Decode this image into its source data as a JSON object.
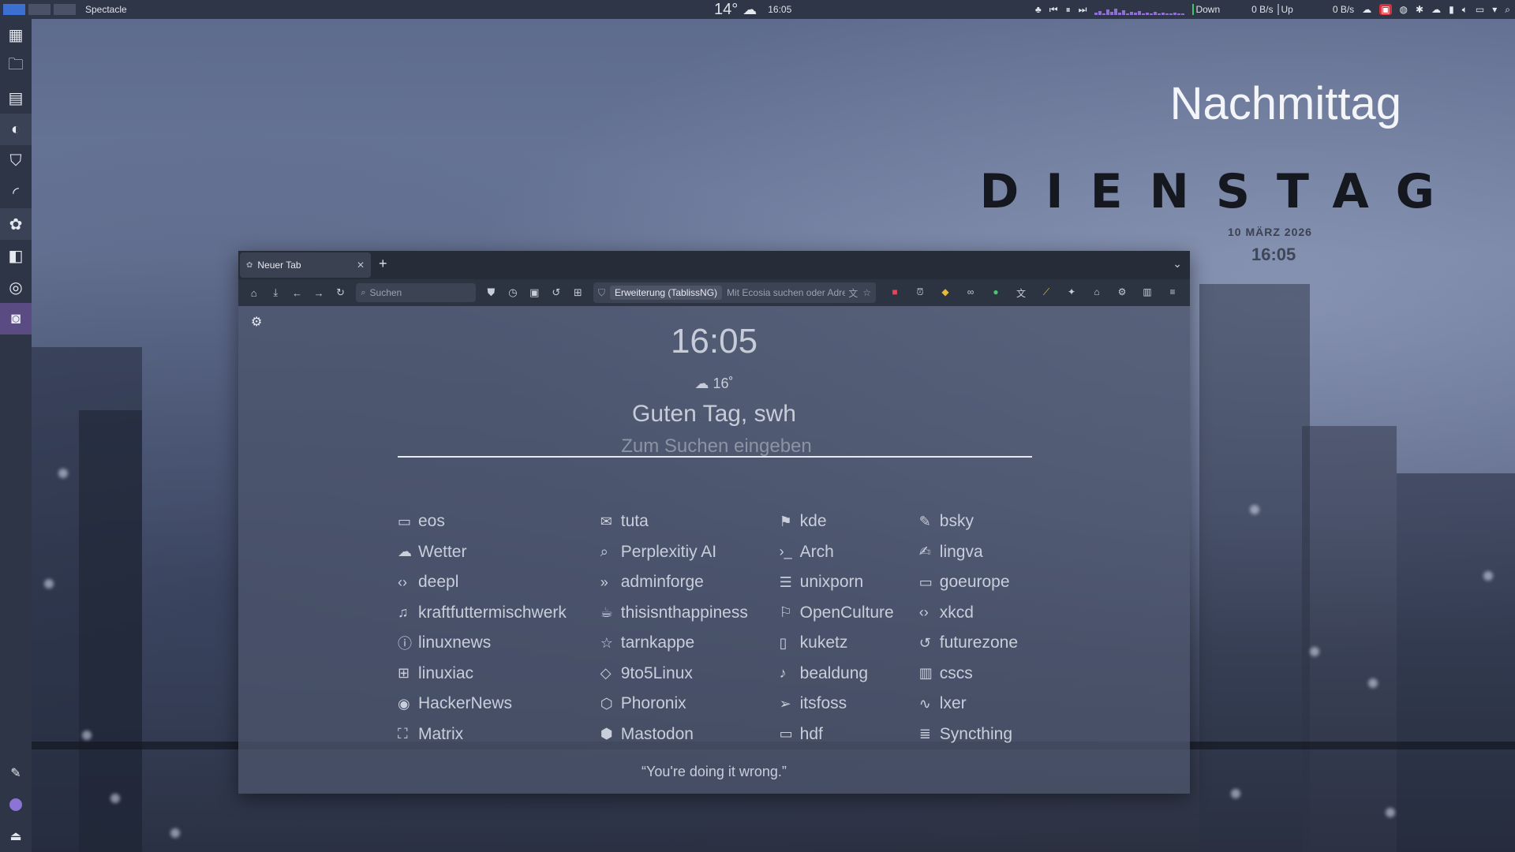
{
  "panel": {
    "app_name": "Spectacle",
    "temperature": "14°",
    "weather_icon": "cloud-icon",
    "time": "16:05",
    "net_down_label": "Down",
    "net_down_rate": "0 B/s",
    "net_up_label": "Up",
    "net_up_rate": "0 B/s"
  },
  "desktop": {
    "day_part": "Nachmittag",
    "weekday": "DIENSTAG",
    "date": "10 MÄRZ 2026",
    "time": "16:05"
  },
  "browser": {
    "tab_title": "Neuer Tab",
    "new_tab": "+",
    "search_placeholder": "Suchen",
    "extension_chip": "Erweiterung (TablissNG)",
    "url_placeholder": "Mit Ecosia suchen oder Adresse eingeben"
  },
  "newtab": {
    "time": "16:05",
    "weather": "16˚",
    "greeting": "Guten Tag, swh",
    "search_placeholder": "Zum Suchen eingeben",
    "quote": "“You're doing it wrong.”",
    "links": [
      [
        {
          "label": "eos",
          "icon": "monitor-icon",
          "glyph": "▭"
        },
        {
          "label": "tuta",
          "icon": "mail-icon",
          "glyph": "✉"
        },
        {
          "label": "kde",
          "icon": "flag-icon",
          "glyph": "⚑"
        },
        {
          "label": "bsky",
          "icon": "pen-icon",
          "glyph": "✎"
        }
      ],
      [
        {
          "label": "Wetter",
          "icon": "cloud-icon",
          "glyph": "☁"
        },
        {
          "label": "Perplexitiy AI",
          "icon": "search-icon",
          "glyph": "⌕"
        },
        {
          "label": "Arch",
          "icon": "terminal-icon",
          "glyph": "›_"
        },
        {
          "label": "lingva",
          "icon": "edit-icon",
          "glyph": "✍"
        }
      ],
      [
        {
          "label": "deepl",
          "icon": "code-icon",
          "glyph": "‹›"
        },
        {
          "label": "adminforge",
          "icon": "chevrons-right-icon",
          "glyph": "»"
        },
        {
          "label": "unixporn",
          "icon": "list-icon",
          "glyph": "☰"
        },
        {
          "label": "goeurope",
          "icon": "credit-card-icon",
          "glyph": "▭"
        }
      ],
      [
        {
          "label": "kraftfuttermischwerk",
          "icon": "music-icon",
          "glyph": "♫"
        },
        {
          "label": "thisisnthappiness",
          "icon": "coffee-icon",
          "glyph": "☕"
        },
        {
          "label": "OpenCulture",
          "icon": "bookmark-icon",
          "glyph": "⚐"
        },
        {
          "label": "xkcd",
          "icon": "code-icon",
          "glyph": "‹›"
        }
      ],
      [
        {
          "label": "linuxnews",
          "icon": "info-icon",
          "glyph": "ⓘ"
        },
        {
          "label": "tarnkappe",
          "icon": "star-icon",
          "glyph": "☆"
        },
        {
          "label": "kuketz",
          "icon": "book-icon",
          "glyph": "▯"
        },
        {
          "label": "futurezone",
          "icon": "rotate-icon",
          "glyph": "↺"
        }
      ],
      [
        {
          "label": "linuxiac",
          "icon": "grid-icon",
          "glyph": "⊞"
        },
        {
          "label": "9to5Linux",
          "icon": "droplet-icon",
          "glyph": "◇"
        },
        {
          "label": "bealdung",
          "icon": "bell-icon",
          "glyph": "♪"
        },
        {
          "label": "cscs",
          "icon": "bar-chart-icon",
          "glyph": "▥"
        }
      ],
      [
        {
          "label": "HackerNews",
          "icon": "eye-icon",
          "glyph": "◉"
        },
        {
          "label": "Phoronix",
          "icon": "package-icon",
          "glyph": "⬡"
        },
        {
          "label": "itsfoss",
          "icon": "send-icon",
          "glyph": "➢"
        },
        {
          "label": "lxer",
          "icon": "activity-icon",
          "glyph": "∿"
        }
      ],
      [
        {
          "label": "Matrix",
          "icon": "maximize-icon",
          "glyph": "⛶"
        },
        {
          "label": "Mastodon",
          "icon": "codesandbox-icon",
          "glyph": "⬢"
        },
        {
          "label": "hdf",
          "icon": "tv-icon",
          "glyph": "▭"
        },
        {
          "label": "Syncthing",
          "icon": "server-icon",
          "glyph": "≣"
        }
      ]
    ]
  }
}
